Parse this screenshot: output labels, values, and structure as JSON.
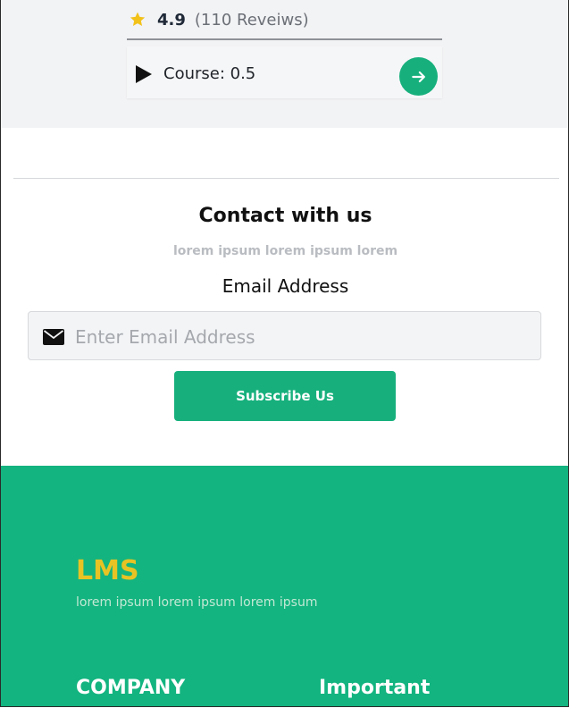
{
  "course_card": {
    "rating": "4.9",
    "reviews": "(110 Reveiws)",
    "course_label": "Course: 0.5",
    "icons": {
      "star": "star-icon",
      "play": "play-icon",
      "go": "arrow-right-icon"
    }
  },
  "contact": {
    "title": "Contact with us",
    "subtitle": "lorem ipsum lorem ipsum lorem",
    "email_label": "Email Address",
    "email_placeholder": "Enter Email Address",
    "email_value": "",
    "subscribe_label": "Subscribe Us",
    "icons": {
      "mail": "mail-icon"
    }
  },
  "footer": {
    "logo": "LMS",
    "tagline": "lorem ipsum lorem ipsum lorem ipsum",
    "columns": [
      "COMPANY",
      "Important"
    ]
  },
  "colors": {
    "accent_green": "#17b07d",
    "footer_green": "#13b47f",
    "logo_yellow": "#e8c324",
    "star_yellow": "#f2c21a"
  }
}
